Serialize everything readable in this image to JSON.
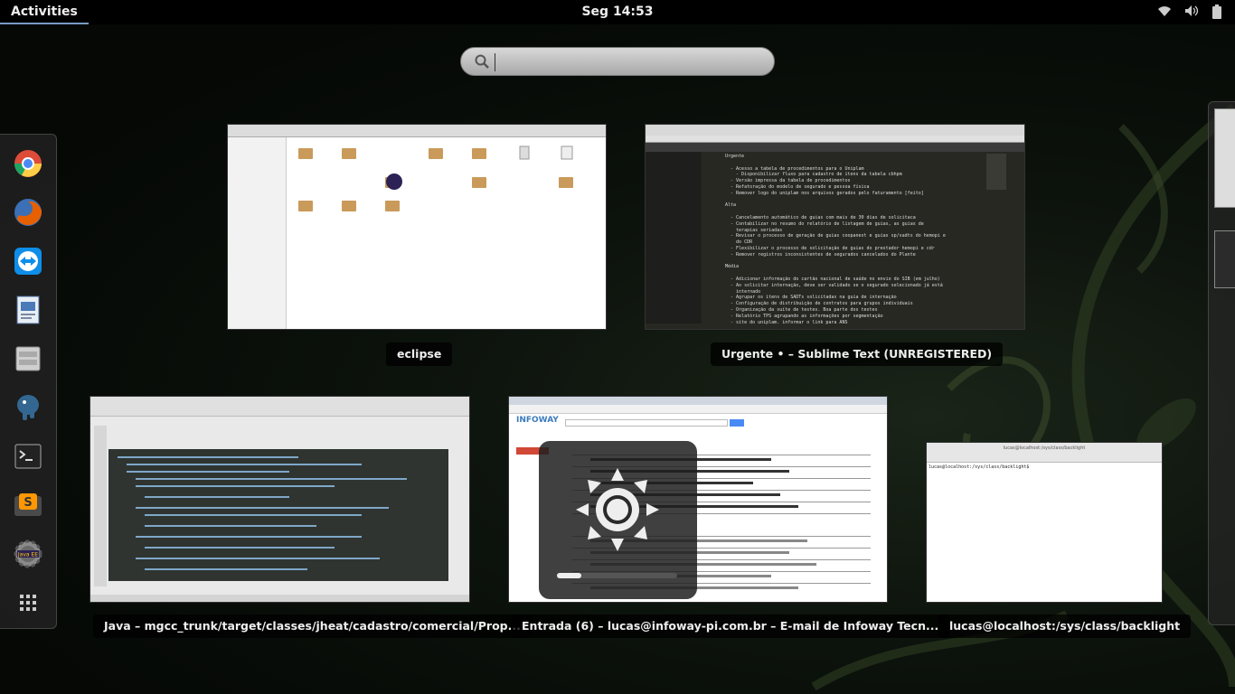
{
  "topbar": {
    "activities_label": "Activities",
    "clock": "Seg 14:53",
    "icons": [
      "wifi-icon",
      "volume-icon",
      "battery-icon"
    ]
  },
  "search": {
    "placeholder": "",
    "value": ""
  },
  "dash": {
    "apps": [
      "chrome-icon",
      "firefox-icon",
      "teamviewer-icon",
      "document-viewer-icon",
      "files-icon",
      "postgresql-icon",
      "terminal-icon",
      "sublime-text-icon",
      "eclipse-ee-icon",
      "show-applications-icon"
    ]
  },
  "windows": {
    "eclipse": {
      "title": "eclipse"
    },
    "sublime": {
      "title": "Urgente • – Sublime Text (UNREGISTERED)",
      "lines": [
        "Urgente",
        "",
        "  - Acesso a tabela de procedimentos para o Uniplam",
        "    - Disponibilizar fluxo para cadastro de itens da tabela cbhpm",
        "  - Versão impressa da tabela de procedimentos",
        "  - Refatoração do modelo de segurado e pessoa física",
        "  - Remover logo do uniplam nos arquivos gerados pelo faturamento [feito]",
        "",
        "Alta",
        "",
        "  - Cancelamento automático de guias com mais de 30 dias de solicitaca",
        "  - Contabilizar no resumo do relatório de listagem de guias, as guias de",
        "    terapias seriadas",
        "  - Revisar o processo de geração de guias coopanest e guias sp/sadts do hemopi e",
        "    do CDR",
        "  - Flexibilizar o processo de solicitação de guias do prestador hemopi e cdr",
        "  - Remover registros inconsistentes de segurados cancelados do Plante",
        "",
        "Média",
        "",
        "  - Adicionar informação do cartão nacional de saúde no envio do SIB (em julho)",
        "  - Ao solicitar internação, deve ser validado se o segurado selecionado já está",
        "    internado",
        "  - Agrupar os itens de SADTs solicitadas na guia de internação",
        "  - Configuração de distribuição de contratos para grupos individuais",
        "  - Organização da suíte de testes. Boa parte dos testes",
        "  - Relatório TPS agrupando as informações por segmentação",
        "  - site do uniplam. informar o link para ANS"
      ]
    },
    "java": {
      "title": "Java – mgcc_trunk/target/classes/jheat/cadastro/comercial/Prop..."
    },
    "mail": {
      "title": "Entrada (6) – lucas@infoway-pi.com.br – E-mail de Infoway Tecn...",
      "brand": "INFOWAY"
    },
    "terminal": {
      "title": "lucas@localhost:/sys/class/backlight",
      "window_title": "lucas@localhost:/sys/class/backlight",
      "prompt": "lucas@localhost:/sys/class/backlight$ "
    }
  },
  "osd": {
    "brightness": 0.2
  }
}
